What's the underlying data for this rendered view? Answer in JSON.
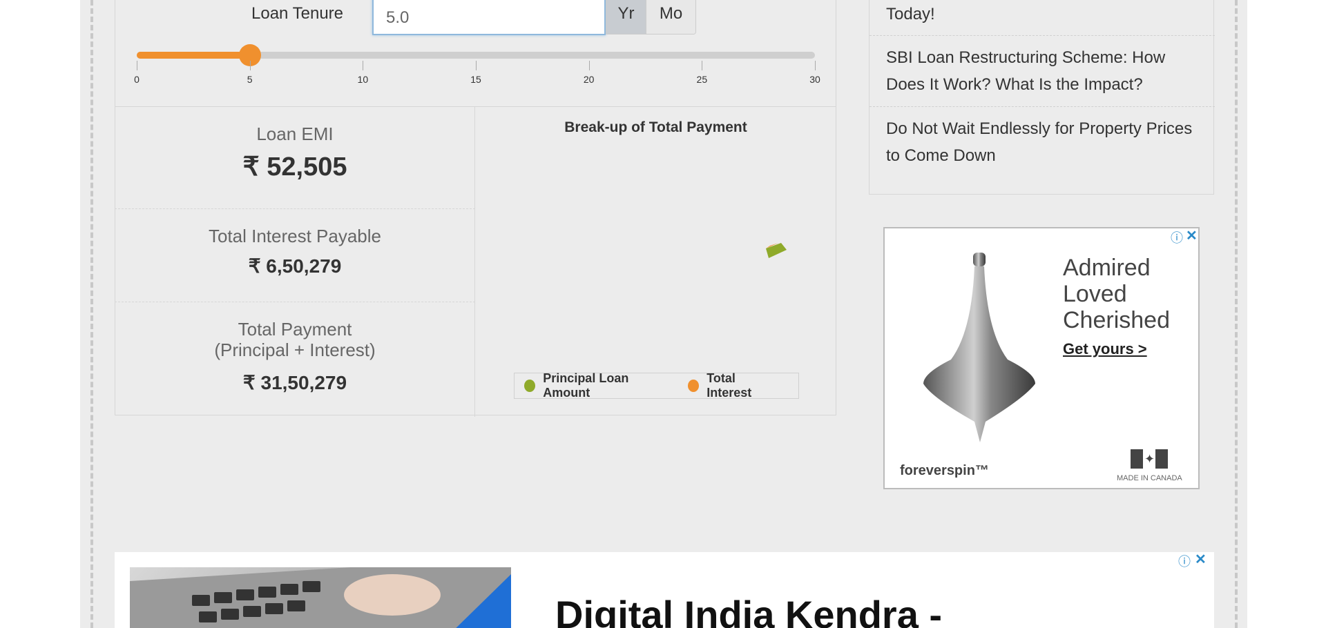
{
  "calculator": {
    "tenure_label": "Loan Tenure",
    "tenure_value": "5.0",
    "unit_year": "Yr",
    "unit_month": "Mo",
    "slider": {
      "min": 0,
      "max": 30,
      "value": 5,
      "ticks": [
        "0",
        "5",
        "10",
        "15",
        "20",
        "25",
        "30"
      ]
    }
  },
  "results": {
    "emi_label": "Loan EMI",
    "emi_value": "₹ 52,505",
    "interest_label": "Total Interest Payable",
    "interest_value": "₹ 6,50,279",
    "payment_label_line1": "Total Payment",
    "payment_label_line2": "(Principal + Interest)",
    "payment_value": "₹ 31,50,279"
  },
  "chart": {
    "title": "Break-up of Total Payment",
    "legend_principal": "Principal Loan Amount",
    "legend_interest": "Total Interest",
    "color_principal": "#8faa2a",
    "color_interest": "#f0902e"
  },
  "sidebar": {
    "articles": [
      "Today!",
      "SBI Loan Restructuring Scheme: How Does It Work? What Is the Impact?",
      "Do Not Wait Endlessly for Property Prices to Come Down"
    ]
  },
  "ad_right": {
    "line1": "Admired",
    "line2": "Loved",
    "line3": "Cherished",
    "cta": "Get yours >",
    "brand": "foreverspin™",
    "badge": "MADE IN CANADA"
  },
  "ad_bottom": {
    "headline": "Digital India Kendra -"
  },
  "colors": {
    "accent": "#f0902e",
    "ad_icon": "#2a8ac8"
  }
}
